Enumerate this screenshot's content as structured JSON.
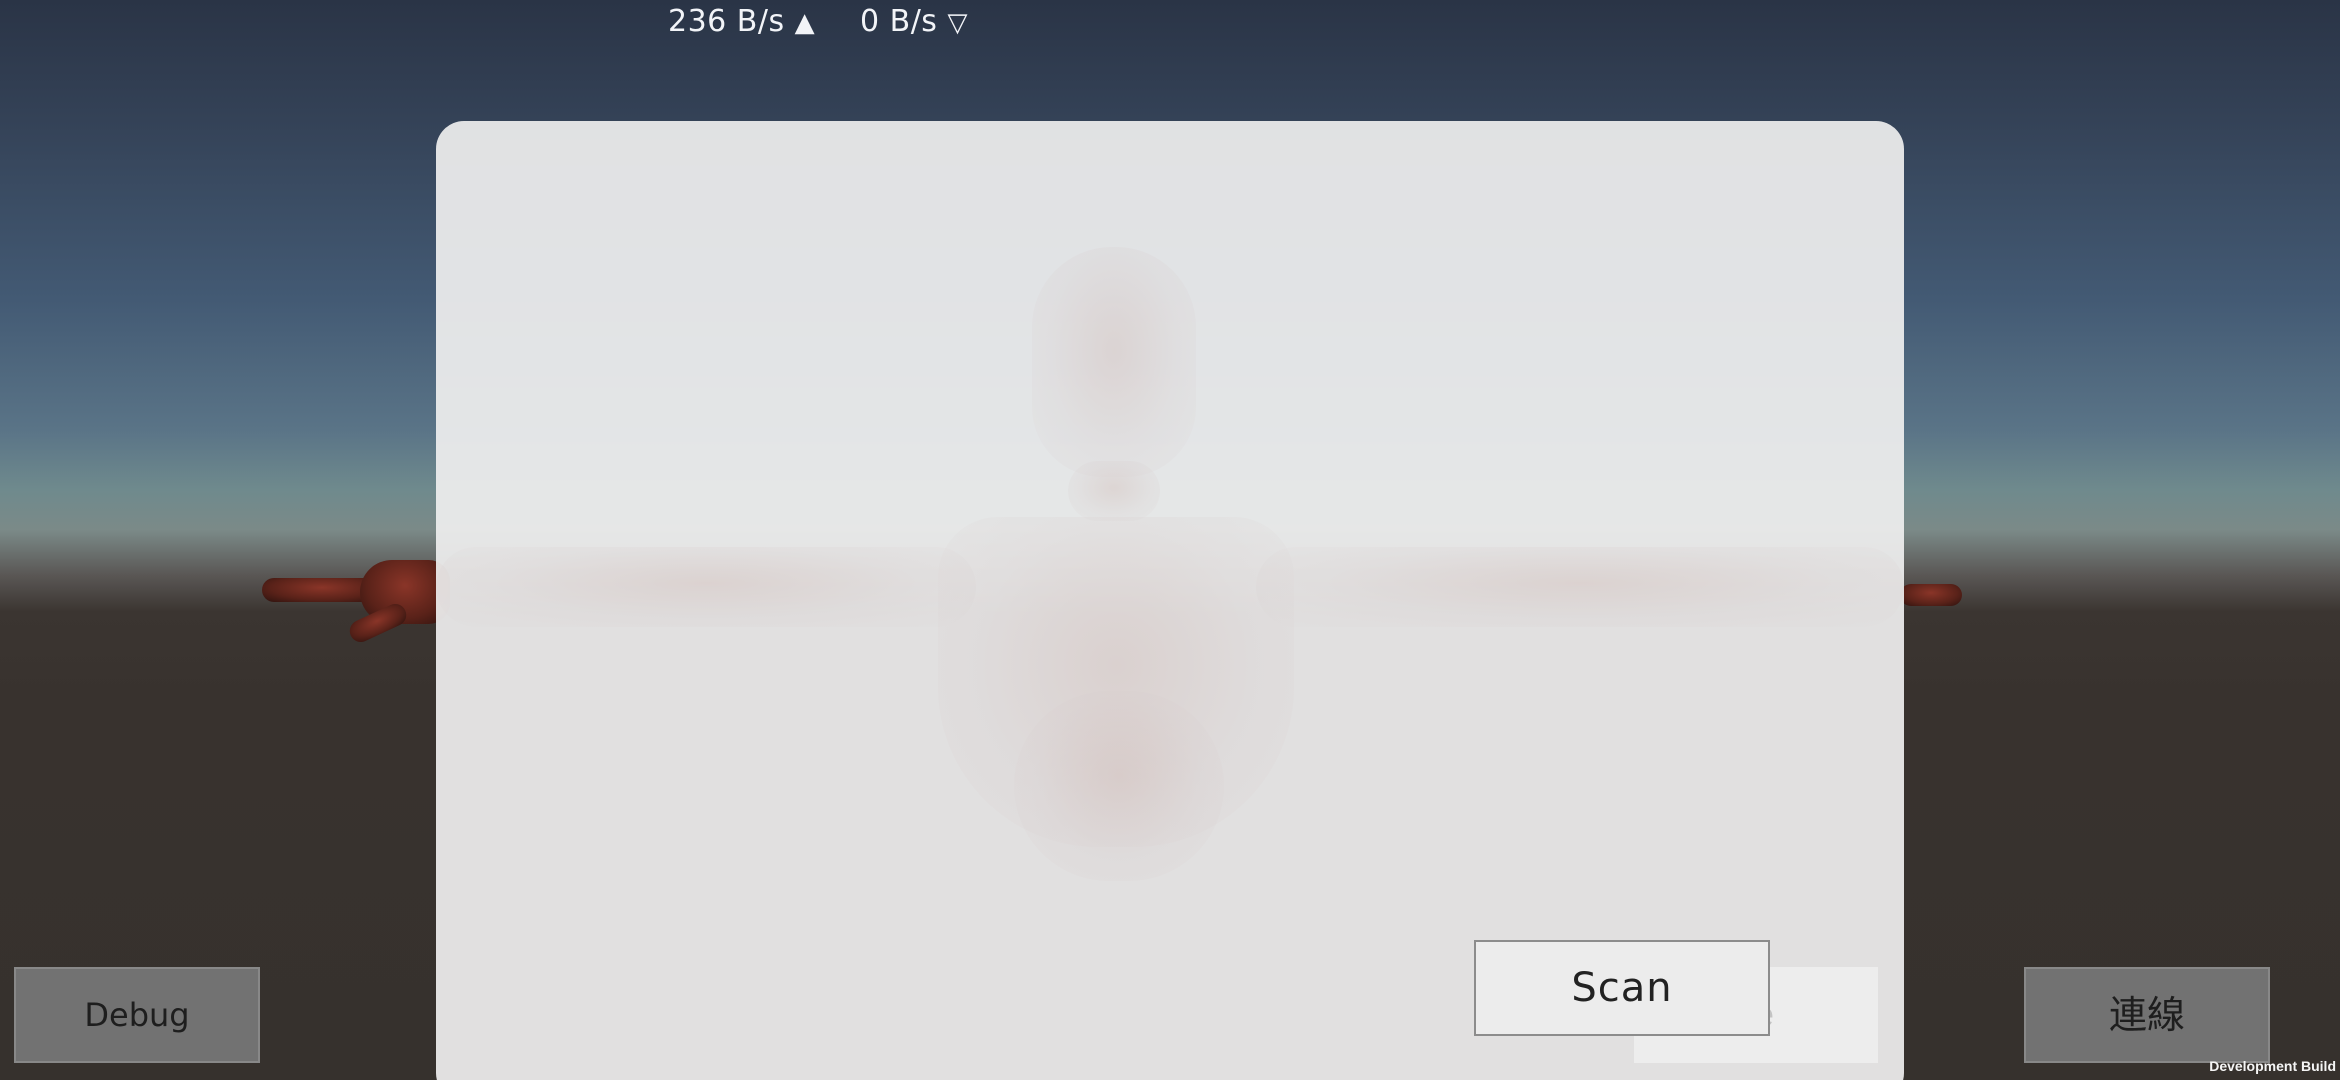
{
  "network": {
    "upload": "236 B/s",
    "upload_arrow": "▲",
    "download": "0 B/s",
    "download_arrow": "▽"
  },
  "panel": {
    "scan_label": "Scan",
    "obscured_button_label": "Te"
  },
  "buttons": {
    "debug_label": "Debug",
    "connect_label": "連線"
  },
  "footer": {
    "build_label": "Development Build"
  }
}
